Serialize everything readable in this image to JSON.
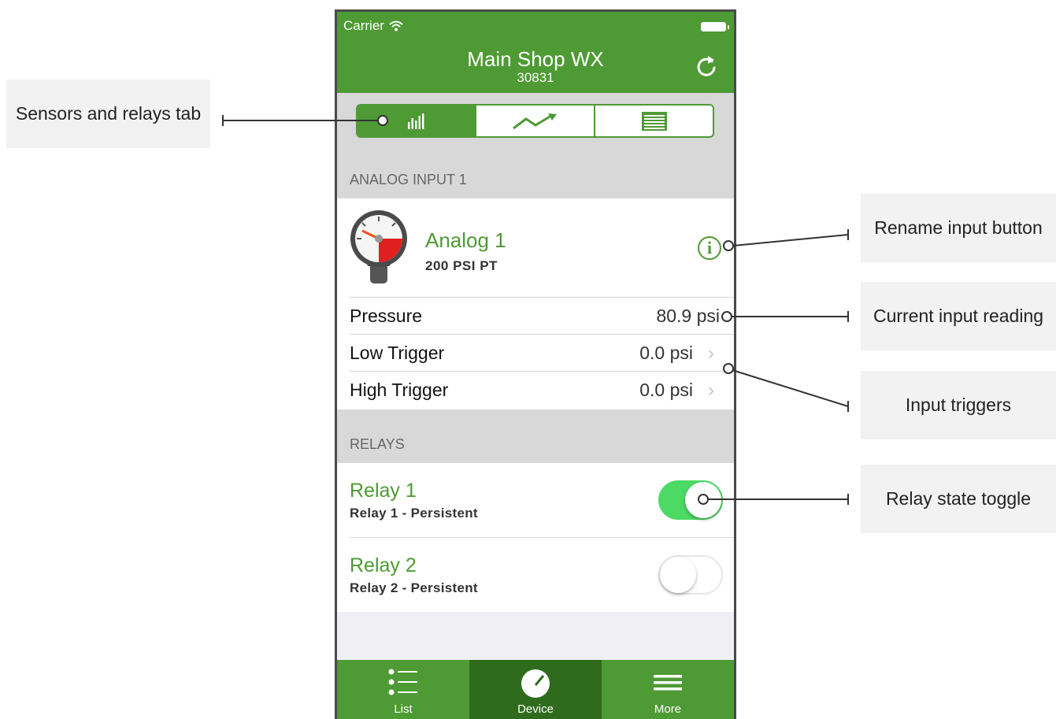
{
  "colors": {
    "brand_green": "#4e9a34",
    "tab_active": "#2f6b1c",
    "toggle_on": "#4cd964",
    "section_bg": "#d8d8d8"
  },
  "status_bar": {
    "carrier": "Carrier"
  },
  "nav": {
    "title": "Main Shop WX",
    "subtitle": "30831",
    "refresh_icon": "refresh-icon"
  },
  "segments": [
    {
      "icon": "bar-chart-icon",
      "active": true
    },
    {
      "icon": "trend-line-icon",
      "active": false
    },
    {
      "icon": "table-grid-icon",
      "active": false
    }
  ],
  "analog_section": {
    "header": "ANALOG INPUT 1",
    "sensor": {
      "name": "Analog 1",
      "subtitle": "200 PSI PT",
      "icon": "pressure-gauge-icon"
    },
    "rows": [
      {
        "label": "Pressure",
        "value": "80.9 psi",
        "chevron": false
      },
      {
        "label": "Low Trigger",
        "value": "0.0 psi",
        "chevron": true
      },
      {
        "label": "High Trigger",
        "value": "0.0 psi",
        "chevron": true
      }
    ]
  },
  "relays_section": {
    "header": "RELAYS",
    "relays": [
      {
        "name": "Relay 1",
        "subtitle": "Relay 1 - Persistent",
        "on": true
      },
      {
        "name": "Relay 2",
        "subtitle": "Relay 2 - Persistent",
        "on": false
      }
    ]
  },
  "tabbar": [
    {
      "label": "List",
      "icon": "list-icon",
      "active": false
    },
    {
      "label": "Device",
      "icon": "device-dial-icon",
      "active": true
    },
    {
      "label": "More",
      "icon": "menu-icon",
      "active": false
    }
  ],
  "callouts": {
    "sensors_tab": "Sensors and relays tab",
    "rename": "Rename input button",
    "reading": "Current input reading",
    "triggers": "Input triggers",
    "relay_toggle": "Relay state toggle"
  }
}
